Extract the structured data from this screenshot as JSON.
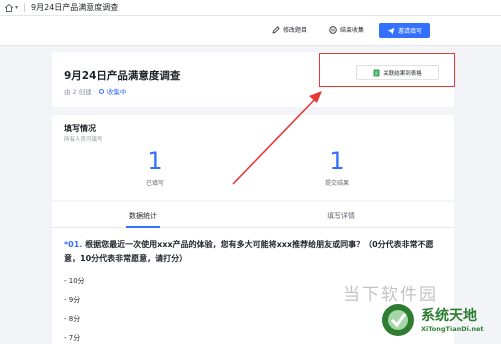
{
  "topbar": {
    "title": "9月24日产品满意度调查"
  },
  "toolbar": {
    "edit_label": "修改题目",
    "end_label": "结束收集",
    "invite_label": "邀请填写"
  },
  "survey": {
    "title": "9月24日产品满意度调查",
    "creator": "由 2 创建 ·",
    "status": "收集中",
    "link_button_label": "关联结果到表格"
  },
  "stats": {
    "title": "填写情况",
    "subtitle": "所有人员可填写",
    "filled_count": "1",
    "filled_label": "已填写",
    "submitted_count": "1",
    "submitted_label": "提交结果"
  },
  "tabs": {
    "stats_label": "数据统计",
    "details_label": "填写详情"
  },
  "question": {
    "number": "*01.",
    "text": "根据您最近一次使用xxx产品的体验，您有多大可能将xxx推荐给朋友或同事？（0分代表非常不愿意，10分代表非常愿意，请打分）",
    "options": [
      "- 10分",
      "- 9分",
      "- 8分",
      "- 7分"
    ]
  },
  "watermark": {
    "line1": "当下软件园",
    "line2": "系统天地",
    "line3": "XiTongTianDi.net"
  },
  "colors": {
    "accent": "#3370ff",
    "highlight": "#e53935"
  }
}
